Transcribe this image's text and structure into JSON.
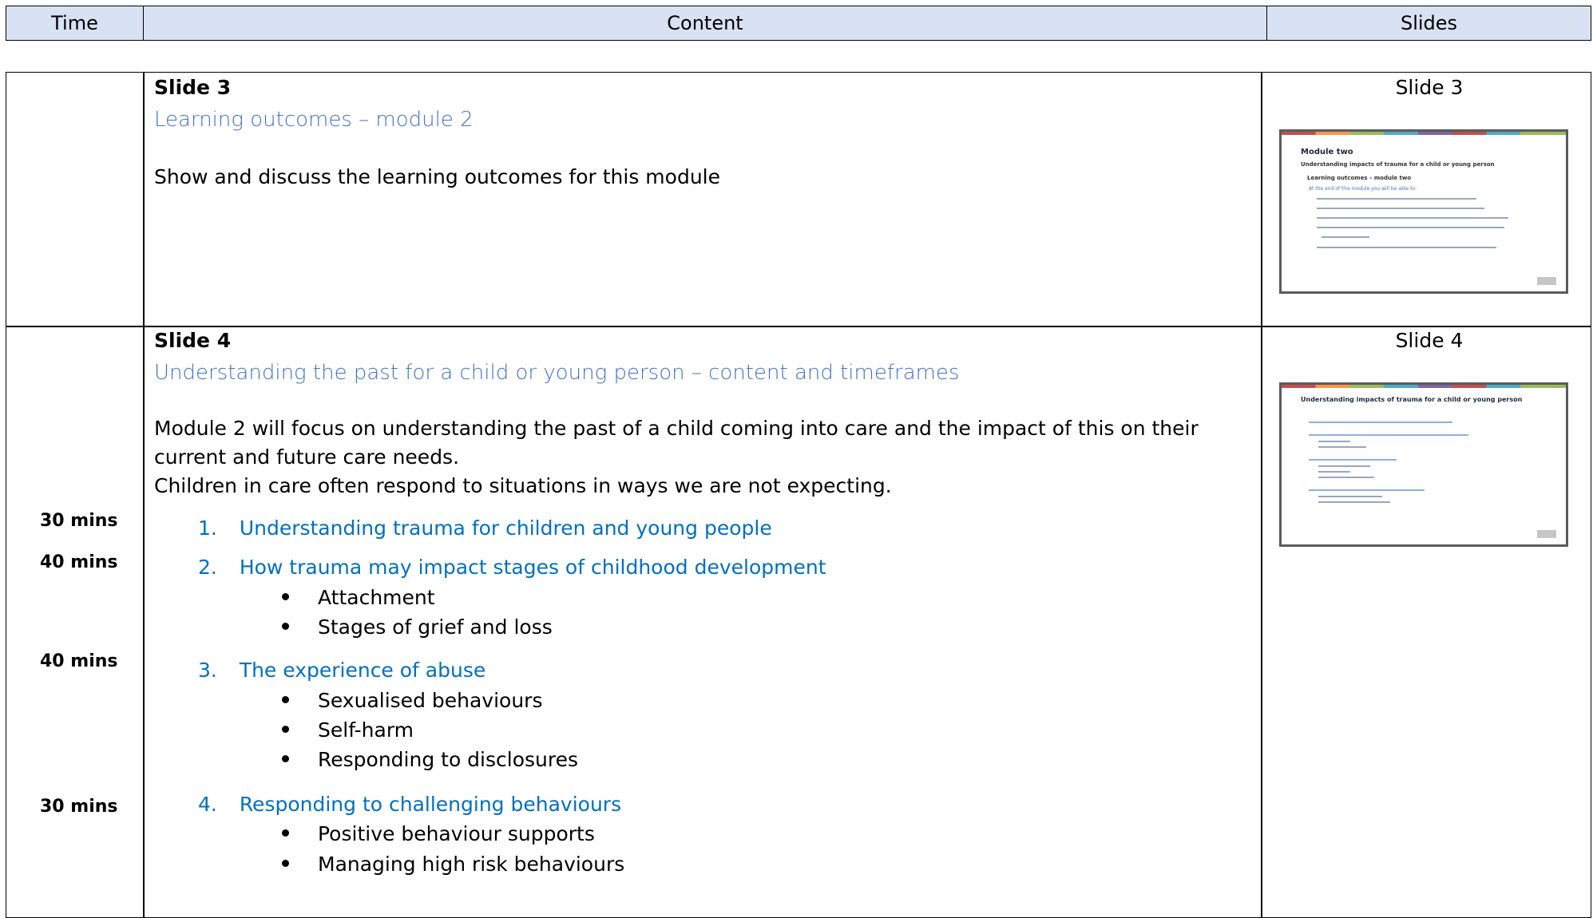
{
  "header": {
    "col_time": "Time",
    "col_content": "Content",
    "col_slides": "Slides"
  },
  "row1": {
    "slide_label": "Slide 3",
    "subheading": "Learning outcomes – module 2",
    "text": "Show and discuss the learning outcomes for this module",
    "slide_ref": "Slide 3",
    "thumbnail": {
      "title": "Module two",
      "subtitle": "Understanding impacts of trauma for a child or young person",
      "section": "Learning outcomes – module two",
      "intro": "At the end of this module you will be able to:"
    }
  },
  "row2": {
    "slide_label": "Slide 4",
    "subheading": "Understanding the past for a child or young person – content and timeframes",
    "para1": "Module 2 will focus on understanding the past of a child coming into care and the impact of this on their current and future care needs.",
    "para2": "Children in care often respond to situations in ways we are not expecting.",
    "slide_ref": "Slide 4",
    "thumbnail": {
      "title": "Understanding impacts of trauma for a child or young person"
    },
    "items": [
      {
        "time": "30 mins",
        "num": "1.",
        "label": "Understanding trauma for children and young people",
        "bullets": []
      },
      {
        "time": "40 mins",
        "num": "2.",
        "label": "How trauma may impact stages of childhood development",
        "bullets": [
          "Attachment",
          "Stages of grief and loss"
        ]
      },
      {
        "time": "40 mins",
        "num": "3.",
        "label": "The experience of abuse",
        "bullets": [
          "Sexualised behaviours",
          "Self-harm",
          "Responding to disclosures"
        ]
      },
      {
        "time": "30 mins",
        "num": "4.",
        "label": "Responding to challenging behaviours",
        "bullets": [
          "Positive behaviour supports",
          "Managing high risk behaviours"
        ]
      }
    ]
  }
}
